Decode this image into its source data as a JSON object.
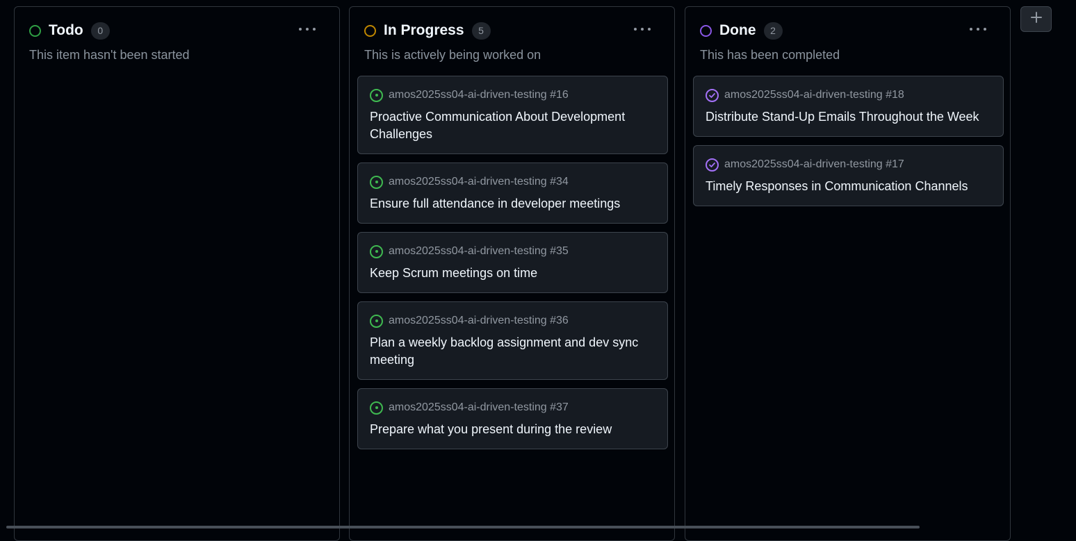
{
  "colors": {
    "todo": "#2f9e44",
    "in_progress": "#bf8700",
    "done": "#8957e5",
    "open_issue": "#3fb950",
    "closed_issue": "#a371f7"
  },
  "columns": [
    {
      "title": "Todo",
      "count": "0",
      "description": "This item hasn't been started",
      "cards": []
    },
    {
      "title": "In Progress",
      "count": "5",
      "description": "This is actively being worked on",
      "cards": [
        {
          "ref": "amos2025ss04-ai-driven-testing #16",
          "title": "Proactive Communication About Development Challenges",
          "icon": "open-issue-icon"
        },
        {
          "ref": "amos2025ss04-ai-driven-testing #34",
          "title": "Ensure full attendance in developer meetings",
          "icon": "open-issue-icon"
        },
        {
          "ref": "amos2025ss04-ai-driven-testing #35",
          "title": "Keep Scrum meetings on time",
          "icon": "open-issue-icon"
        },
        {
          "ref": "amos2025ss04-ai-driven-testing #36",
          "title": "Plan a weekly backlog assignment and dev sync meeting",
          "icon": "open-issue-icon"
        },
        {
          "ref": "amos2025ss04-ai-driven-testing #37",
          "title": "Prepare what you present during the review",
          "icon": "open-issue-icon"
        }
      ]
    },
    {
      "title": "Done",
      "count": "2",
      "description": "This has been completed",
      "cards": [
        {
          "ref": "amos2025ss04-ai-driven-testing #18",
          "title": "Distribute Stand-Up Emails Throughout the Week",
          "icon": "closed-issue-icon"
        },
        {
          "ref": "amos2025ss04-ai-driven-testing #17",
          "title": "Timely Responses in Communication Channels",
          "icon": "closed-issue-icon"
        }
      ]
    }
  ],
  "add_column_icon": "plus-icon"
}
